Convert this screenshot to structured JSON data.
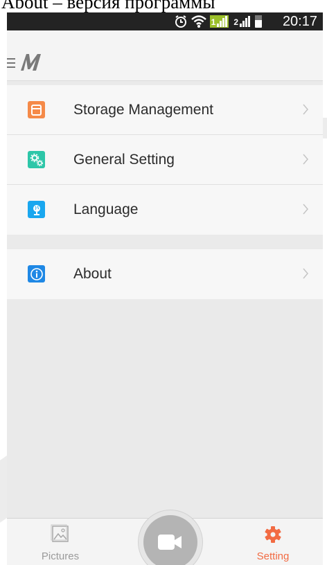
{
  "doc_caption": "About – версия программы",
  "status_bar": {
    "time": "20:17",
    "sim1_label": "1",
    "sim2_label": "2",
    "icons": [
      "alarm-icon",
      "wifi-icon",
      "signal-sim1-icon",
      "signal-sim2-icon",
      "battery-icon"
    ]
  },
  "header": {
    "menu_icon": "hamburger-icon",
    "logo": "m-logo"
  },
  "menu": {
    "items": [
      {
        "label": "Storage Management",
        "icon": "storage-icon",
        "icon_color": "#f58a49"
      },
      {
        "label": "General Setting",
        "icon": "gears-icon",
        "icon_color": "#2dc6a8"
      },
      {
        "label": "Language",
        "icon": "globe-icon",
        "icon_color": "#1aa7ef"
      }
    ],
    "about": {
      "label": "About",
      "icon": "info-icon",
      "icon_color": "#1f88e5"
    }
  },
  "bottom_nav": {
    "pictures_label": "Pictures",
    "setting_label": "Setting",
    "record_icon": "video-camera-icon",
    "active_color": "#f26b43",
    "inactive_color": "#9a9a9a"
  }
}
